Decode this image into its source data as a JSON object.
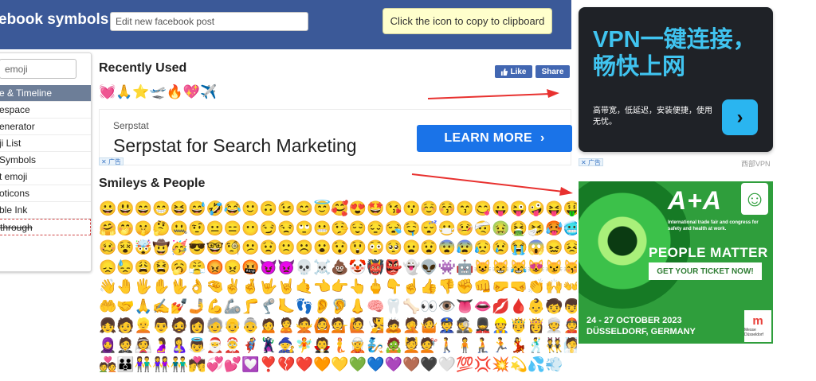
{
  "header": {
    "site_title": "ebook symbols",
    "post_placeholder": "Edit new facebook post",
    "clipboard_note": "Click the icon to copy to clipboard"
  },
  "sidebar": {
    "search_placeholder": "emoji",
    "items": [
      {
        "label": "e & Timeline",
        "state": "active"
      },
      {
        "label": "espace",
        "state": "normal"
      },
      {
        "label": "enerator",
        "state": "normal"
      },
      {
        "label": "ji List",
        "state": "normal"
      },
      {
        "label": "Symbols",
        "state": "normal"
      },
      {
        "label": "t emoji",
        "state": "normal"
      },
      {
        "label": "oticons",
        "state": "normal"
      },
      {
        "label": "ble Ink",
        "state": "normal"
      },
      {
        "label": "through",
        "state": "strikethrough"
      }
    ]
  },
  "main": {
    "recently_used_heading": "Recently Used",
    "recent_emojis": "💓🙏⭐🛫🔥💖✈️",
    "fb_like": "Like",
    "fb_share": "Share",
    "smileys_heading": "Smileys & People",
    "smileys_rows": [
      "😀😃😄😁😆😅🤣😂🙂🙃😉😊😇🥰😍🤩😘😗☺️😚😙😋😛😜🤪😝🤑",
      "🤗🤭🤫🤔🤐🤨😐😑😶😏😒🙄😬🤥😌😔😪🤤😴😷🤒🤕🤢🤮🤧🥵🥶",
      "🥴😵🤯🤠🥳😎🤓🧐😕😟🙁☹️😮😯😲😳🥺😦😧😨😰😥😢😭😱😖😣",
      "😞😓😩😫🥱😤😡😠🤬😈👿💀☠️💩🤡👹👺👻👽👾🤖😺😸😹😻😼😽",
      "👋🤚🖐️✋🖖👌🤏✌️🤞🤟🤘🤙👈👉👆🖕👇☝️👍👎✊👊🤛🤜👏🙌👐",
      "🤲🤝🙏✍️💅🤳💪🦾🦵🦿🦶👣👂🦻👃🧠🦷🦴👀👁️👅👄💋🩸👶🧒👦",
      "👧🧑👱👨🧔👩🧓👴👵🙍🙎🙅🙆💁🙋🧏🙇🤦🤷👮🕵️💂👷🤴👸👳👲",
      "🧕🤵👰🤰🤱👼🎅🤶🦸🦹🧙🧚🧛🧜🧝🧞🧟💆💇🚶🧍🧎🏃💃🕺👯🧖",
      "💑👪👫👭👬💏💞💕💟❣️💔❤️🧡💛💚💙💜🤎🖤🤍💯💢💥💫💦💨"
    ]
  },
  "ad_serpstat": {
    "brand": "Serpstat",
    "headline": "Serpstat for Search Marketing",
    "cta": "LEARN MORE",
    "ad_label": "广告"
  },
  "ad_vpn": {
    "title": "VPN一键连接，畅快上网",
    "subtitle": "高带宽，低延迟，安装便捷，使用无忧。",
    "button_icon": "chevron-right-icon",
    "ad_label": "广告",
    "source": "西部VPN",
    "accent": "#40c4f0"
  },
  "ad_aa": {
    "logo": "A+A",
    "tagline": "International trade fair and congress for safety and health at work.",
    "headline": "PEOPLE MATTER",
    "cta": "GET YOUR TICKET NOW!",
    "dates_line1": "24 - 27 OCTOBER 2023",
    "dates_line2": "DÜSSELDORF, GERMANY",
    "messe": "Messe Düsseldorf",
    "background": "#2f9e3c"
  },
  "colors": {
    "header_bg": "#3b5998",
    "arrow": "#e8312f",
    "fb_blue": "#4267b2",
    "cta_blue": "#1a73e8"
  }
}
